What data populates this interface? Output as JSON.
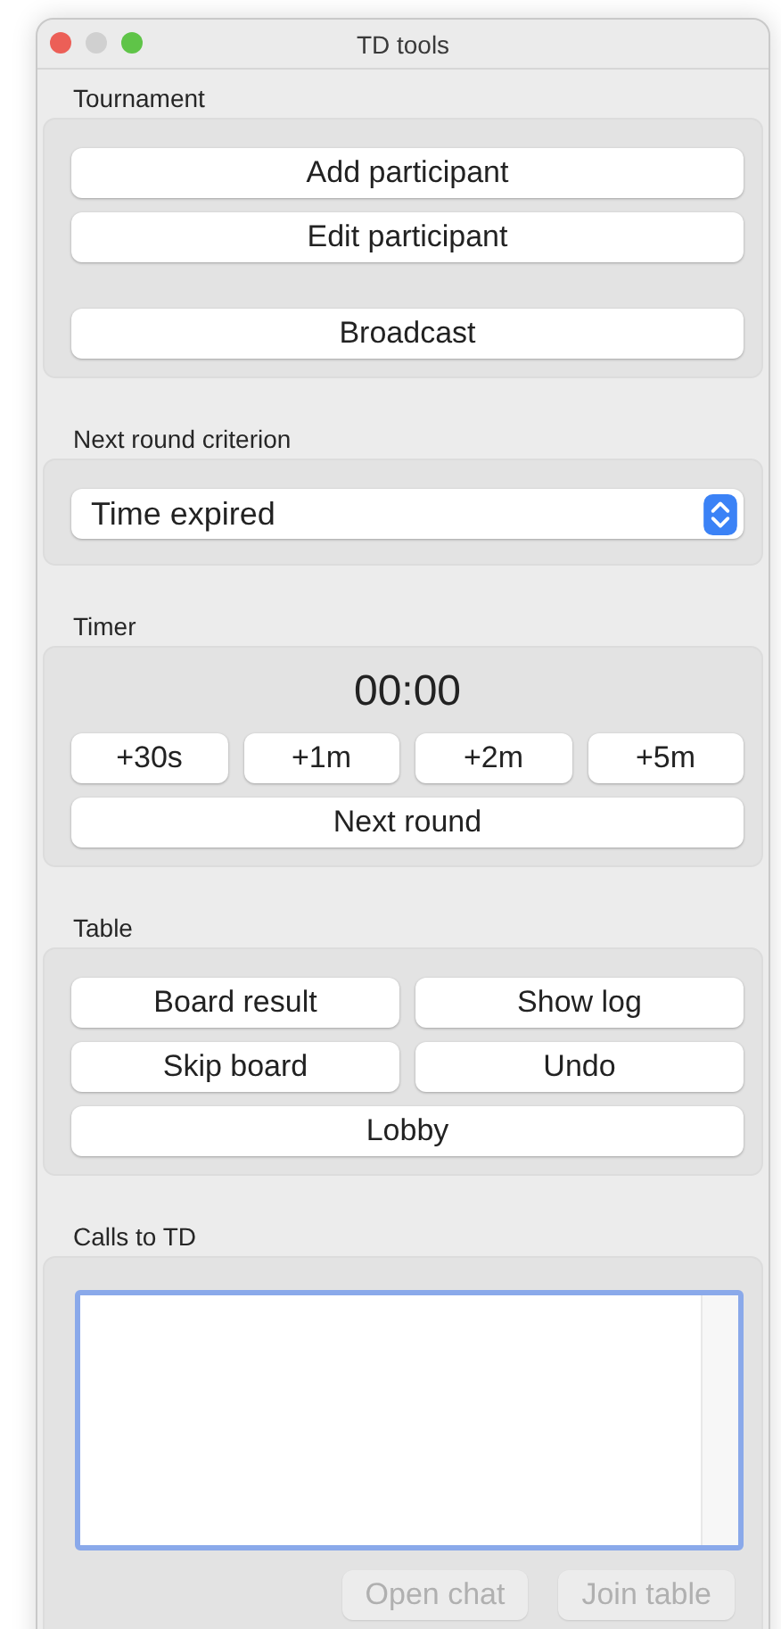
{
  "window": {
    "title": "TD tools"
  },
  "sections": [
    {
      "kind": "buttons",
      "title": "Tournament",
      "groups": [
        [
          [
            {
              "label": "Add participant"
            }
          ],
          [
            {
              "label": "Edit participant"
            }
          ]
        ],
        [
          [
            {
              "label": "Broadcast"
            }
          ]
        ]
      ]
    },
    {
      "kind": "select",
      "title": "Next round criterion",
      "value": "Time expired"
    },
    {
      "kind": "timer",
      "title": "Timer",
      "display": "00:00",
      "groups": [
        [
          [
            {
              "label": "+30s"
            },
            {
              "label": "+1m"
            },
            {
              "label": "+2m"
            },
            {
              "label": "+5m"
            }
          ],
          [
            {
              "label": "Next round"
            }
          ]
        ]
      ]
    },
    {
      "kind": "buttons",
      "title": "Table",
      "groups": [
        [
          [
            {
              "label": "Board result"
            },
            {
              "label": "Show log"
            }
          ],
          [
            {
              "label": "Skip board"
            },
            {
              "label": "Undo"
            }
          ],
          [
            {
              "label": "Lobby"
            }
          ]
        ]
      ]
    },
    {
      "kind": "calls",
      "title": "Calls to TD",
      "field": {
        "focused": true
      },
      "buttons": [
        {
          "label": "Open chat",
          "disabled": true
        },
        {
          "label": "Join table",
          "disabled": true
        }
      ]
    }
  ]
}
